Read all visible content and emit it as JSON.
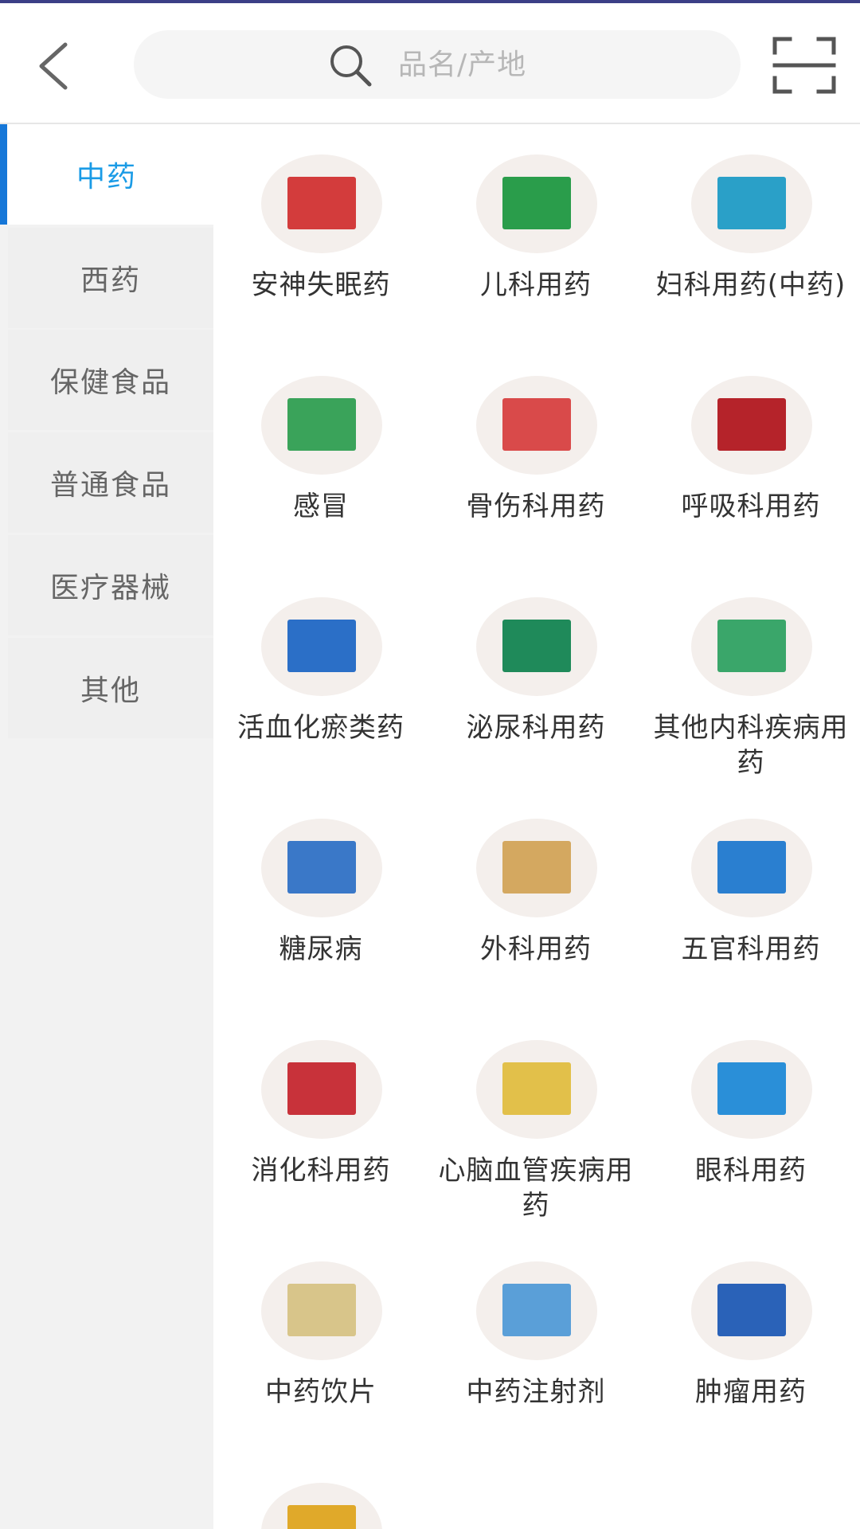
{
  "header": {
    "search_placeholder": "品名/产地"
  },
  "sidebar": {
    "items": [
      {
        "label": "中药",
        "active": true
      },
      {
        "label": "西药"
      },
      {
        "label": "保健食品"
      },
      {
        "label": "普通食品"
      },
      {
        "label": "医疗器械"
      },
      {
        "label": "其他"
      }
    ]
  },
  "categories": [
    {
      "label": "安神失眠药",
      "icon": "medicine-bottle-icon",
      "color": "#d33c3c"
    },
    {
      "label": "儿科用药",
      "icon": "medicine-box-icon",
      "color": "#2a9d4b"
    },
    {
      "label": "妇科用药(中药)",
      "icon": "medicine-box-icon",
      "color": "#2aa0c8"
    },
    {
      "label": "感冒",
      "icon": "medicine-box-icon",
      "color": "#3aa35a"
    },
    {
      "label": "骨伤科用药",
      "icon": "medicine-box-icon",
      "color": "#d94a4a"
    },
    {
      "label": "呼吸科用药",
      "icon": "medicine-box-icon",
      "color": "#b5232a"
    },
    {
      "label": "活血化瘀类药",
      "icon": "medicine-box-icon",
      "color": "#2b6fc7"
    },
    {
      "label": "泌尿科用药",
      "icon": "medicine-pack-icon",
      "color": "#1f8a5a"
    },
    {
      "label": "其他内科疾病用药",
      "icon": "medicine-box-icon",
      "color": "#3aa66a"
    },
    {
      "label": "糖尿病",
      "icon": "medicine-box-icon",
      "color": "#3a78c8"
    },
    {
      "label": "外科用药",
      "icon": "plaster-icon",
      "color": "#d4a860"
    },
    {
      "label": "五官科用药",
      "icon": "medicine-box-icon",
      "color": "#2a7fd0"
    },
    {
      "label": "消化科用药",
      "icon": "medicine-box-icon",
      "color": "#c8323a"
    },
    {
      "label": "心脑血管疾病用药",
      "icon": "medicine-box-icon",
      "color": "#e2c04a"
    },
    {
      "label": "眼科用药",
      "icon": "medicine-box-icon",
      "color": "#2a8fd8"
    },
    {
      "label": "中药饮片",
      "icon": "herb-slices-icon",
      "color": "#d8c58a"
    },
    {
      "label": "中药注射剂",
      "icon": "injection-vial-icon",
      "color": "#5a9fd8"
    },
    {
      "label": "肿瘤用药",
      "icon": "medicine-box-icon",
      "color": "#2a62b8"
    },
    {
      "label": "",
      "icon": "medicine-box-icon",
      "color": "#e0a92a"
    }
  ],
  "colors": {
    "accent": "#1a9be6",
    "active_bar": "#1677d8",
    "top_line": "#3b3f86"
  }
}
